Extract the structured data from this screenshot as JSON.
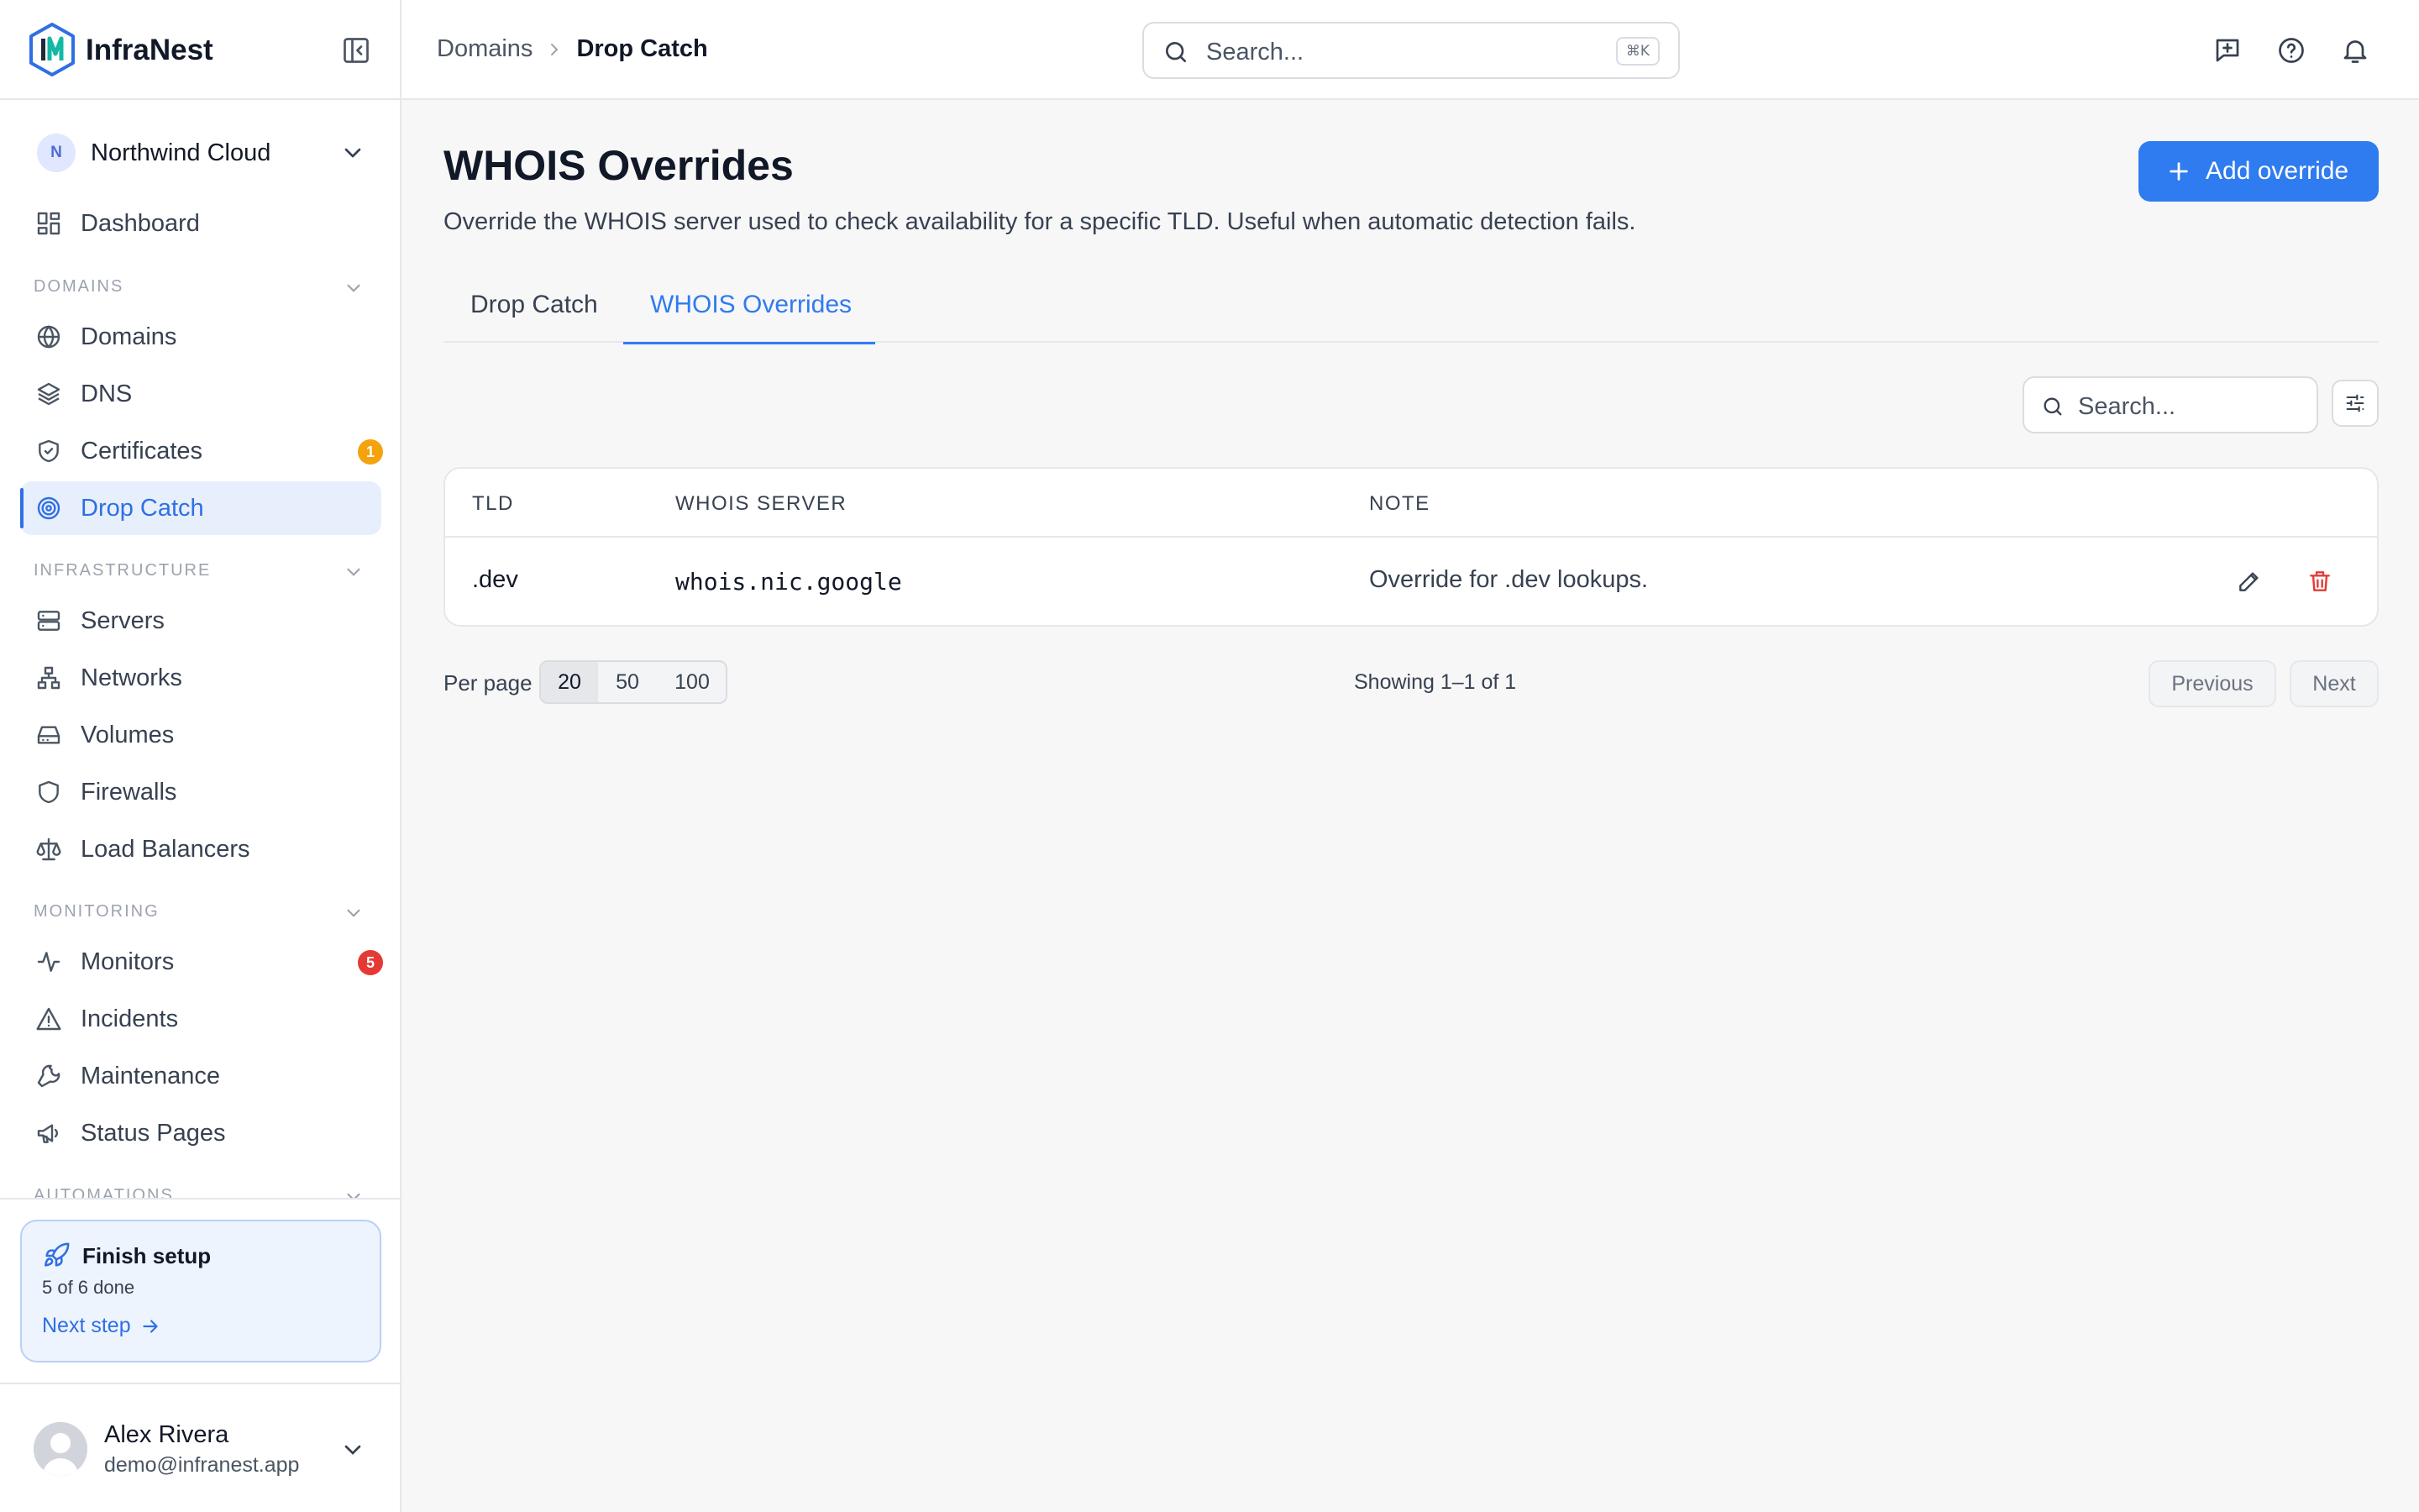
{
  "brand": {
    "name": "InfraNest"
  },
  "org": {
    "initial": "N",
    "name": "Northwind Cloud"
  },
  "nav": {
    "dashboard": "Dashboard",
    "sections": {
      "domains": "DOMAINS",
      "infrastructure": "INFRASTRUCTURE",
      "monitoring": "MONITORING",
      "automations": "AUTOMATIONS"
    },
    "items": {
      "domains": "Domains",
      "dns": "DNS",
      "certificates": "Certificates",
      "drop_catch": "Drop Catch",
      "servers": "Servers",
      "networks": "Networks",
      "volumes": "Volumes",
      "firewalls": "Firewalls",
      "load_balancers": "Load Balancers",
      "monitors": "Monitors",
      "incidents": "Incidents",
      "maintenance": "Maintenance",
      "status_pages": "Status Pages"
    },
    "badges": {
      "certificates": "1",
      "monitors": "5"
    }
  },
  "setup": {
    "title": "Finish setup",
    "progress": "5 of 6 done",
    "next": "Next step"
  },
  "user": {
    "name": "Alex Rivera",
    "email": "demo@infranest.app"
  },
  "breadcrumb": {
    "parent": "Domains",
    "current": "Drop Catch"
  },
  "top_search": {
    "placeholder": "Search...",
    "shortcut": "⌘K"
  },
  "page": {
    "title": "WHOIS Overrides",
    "description": "Override the WHOIS server used to check availability for a specific TLD. Useful when automatic detection fails.",
    "add_button": "Add override"
  },
  "tabs": [
    {
      "label": "Drop Catch",
      "active": false
    },
    {
      "label": "WHOIS Overrides",
      "active": true
    }
  ],
  "table_search": {
    "placeholder": "Search..."
  },
  "table": {
    "headers": {
      "tld": "TLD",
      "server": "WHOIS SERVER",
      "note": "NOTE"
    },
    "rows": [
      {
        "tld": ".dev",
        "server": "whois.nic.google",
        "note": "Override for .dev lookups."
      }
    ]
  },
  "pagination": {
    "per_page_label": "Per page",
    "options": [
      "20",
      "50",
      "100"
    ],
    "selected": "20",
    "showing": "Showing 1–1 of 1",
    "previous": "Previous",
    "next": "Next"
  },
  "colors": {
    "accent": "#2f7bf0",
    "danger": "#e53935",
    "warning": "#f5a20c"
  }
}
